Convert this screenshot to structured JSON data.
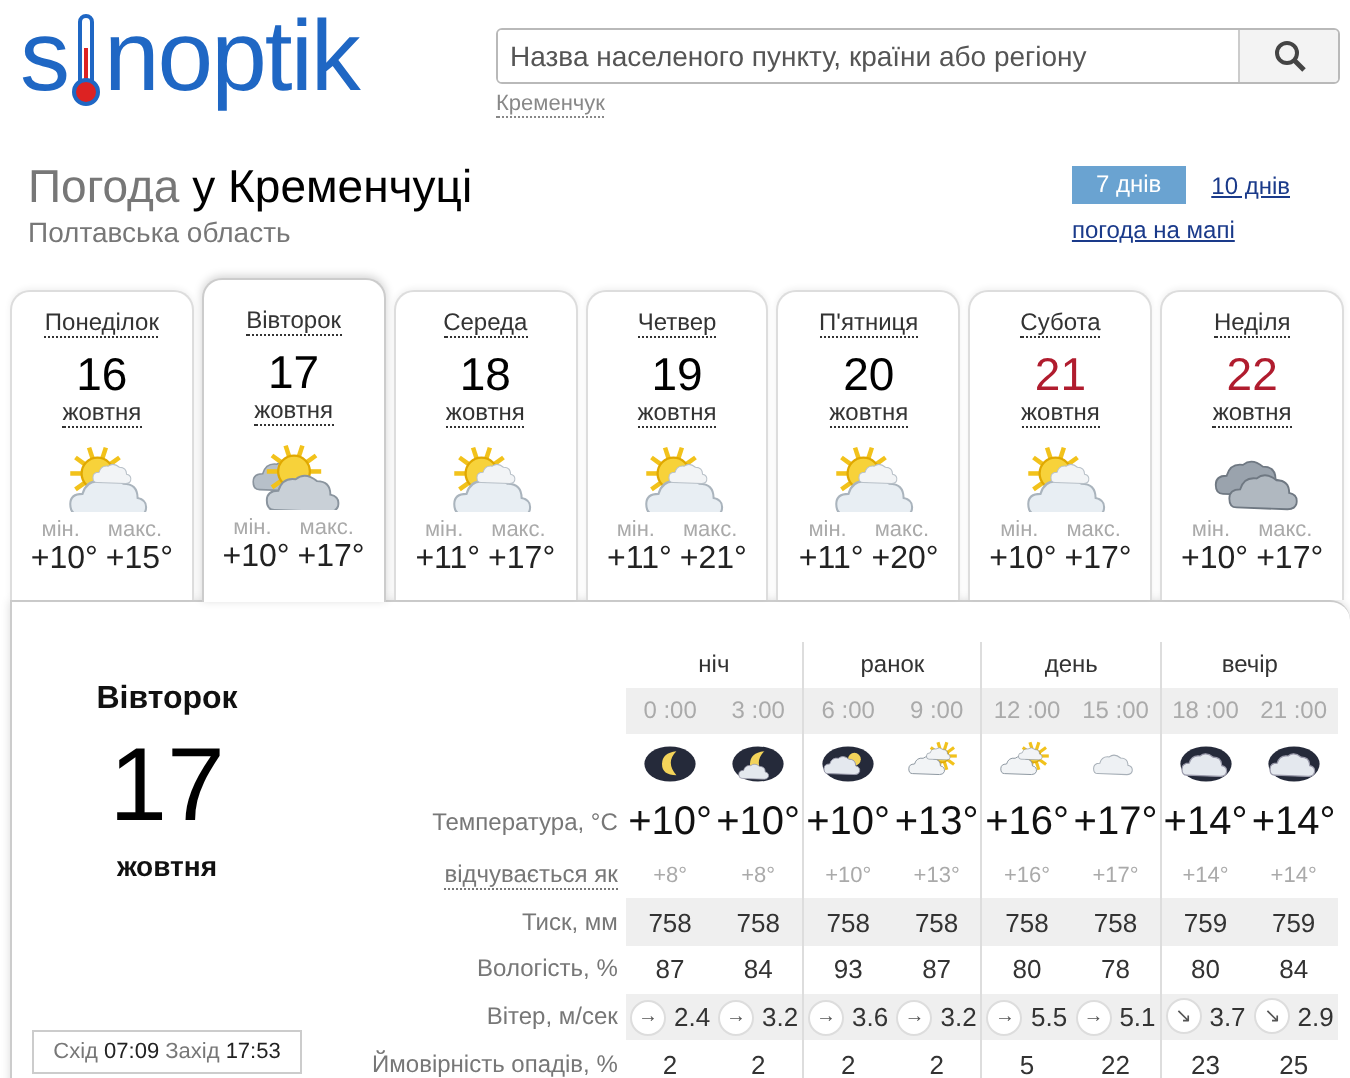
{
  "logo": {
    "before": "s",
    "after": "noptik"
  },
  "search": {
    "placeholder": "Назва населеного пункту, країни або регіону",
    "recent": "Кременчук"
  },
  "title": {
    "prefix": "Погода",
    "place": "у Кременчуці",
    "region": "Полтавська область"
  },
  "views": [
    {
      "label": "7 днів",
      "selected": true
    },
    {
      "label": "10 днів",
      "selected": false
    }
  ],
  "map_link": "погода на мапі",
  "days": [
    {
      "weekday": "Понеділок",
      "day": "16",
      "month": "жовтня",
      "kind": "sun_clouds",
      "min_label": "мін.",
      "max_label": "макс.",
      "min": "+10°",
      "max": "+15°",
      "weekend": false,
      "selected": false
    },
    {
      "weekday": "Вівторок",
      "day": "17",
      "month": "жовтня",
      "kind": "sun_dark_clouds",
      "min_label": "мін.",
      "max_label": "макс.",
      "min": "+10°",
      "max": "+17°",
      "weekend": false,
      "selected": true
    },
    {
      "weekday": "Середа",
      "day": "18",
      "month": "жовтня",
      "kind": "sun_clouds",
      "min_label": "мін.",
      "max_label": "макс.",
      "min": "+11°",
      "max": "+17°",
      "weekend": false,
      "selected": false
    },
    {
      "weekday": "Четвер",
      "day": "19",
      "month": "жовтня",
      "kind": "sun_clouds",
      "min_label": "мін.",
      "max_label": "макс.",
      "min": "+11°",
      "max": "+21°",
      "weekend": false,
      "selected": false
    },
    {
      "weekday": "П'ятниця",
      "day": "20",
      "month": "жовтня",
      "kind": "sun_clouds",
      "min_label": "мін.",
      "max_label": "макс.",
      "min": "+11°",
      "max": "+20°",
      "weekend": false,
      "selected": false
    },
    {
      "weekday": "Субота",
      "day": "21",
      "month": "жовтня",
      "kind": "sun_clouds",
      "min_label": "мін.",
      "max_label": "макс.",
      "min": "+10°",
      "max": "+17°",
      "weekend": true,
      "selected": false
    },
    {
      "weekday": "Неділя",
      "day": "22",
      "month": "жовтня",
      "kind": "overcast",
      "min_label": "мін.",
      "max_label": "макс.",
      "min": "+10°",
      "max": "+17°",
      "weekend": true,
      "selected": false
    }
  ],
  "detail": {
    "weekday": "Вівторок",
    "day": "17",
    "month": "жовтня",
    "sun": {
      "rise_label": "Схід",
      "rise": "07:09",
      "set_label": "Захід",
      "set": "17:53"
    },
    "row_labels": {
      "temperature": "Температура, °C",
      "feels": "відчувається як",
      "pressure": "Тиск, мм",
      "humidity": "Вологість, %",
      "wind": "Вітер, м/сек",
      "precip": "Ймовірність опадів, %"
    },
    "periods": [
      "ніч",
      "ранок",
      "день",
      "вечір"
    ],
    "hours": [
      {
        "time": "0 :00",
        "kind": "night_clear",
        "temp": "+10°",
        "feels": "+8°",
        "pressure": "758",
        "humidity": "87",
        "wind_arrow": "→",
        "wind": "2.4",
        "precip": "2"
      },
      {
        "time": "3 :00",
        "kind": "night_cloud",
        "temp": "+10°",
        "feels": "+8°",
        "pressure": "758",
        "humidity": "84",
        "wind_arrow": "→",
        "wind": "3.2",
        "precip": "2"
      },
      {
        "time": "6 :00",
        "kind": "night_partly",
        "temp": "+10°",
        "feels": "+10°",
        "pressure": "758",
        "humidity": "93",
        "wind_arrow": "→",
        "wind": "3.6",
        "precip": "2"
      },
      {
        "time": "9 :00",
        "kind": "partly",
        "temp": "+13°",
        "feels": "+13°",
        "pressure": "758",
        "humidity": "87",
        "wind_arrow": "→",
        "wind": "3.2",
        "precip": "2"
      },
      {
        "time": "12 :00",
        "kind": "partly",
        "temp": "+16°",
        "feels": "+16°",
        "pressure": "758",
        "humidity": "80",
        "wind_arrow": "→",
        "wind": "5.5",
        "precip": "5"
      },
      {
        "time": "15 :00",
        "kind": "cloud",
        "temp": "+17°",
        "feels": "+17°",
        "pressure": "758",
        "humidity": "78",
        "wind_arrow": "→",
        "wind": "5.1",
        "precip": "22"
      },
      {
        "time": "18 :00",
        "kind": "night_cloudy",
        "temp": "+14°",
        "feels": "+14°",
        "pressure": "759",
        "humidity": "80",
        "wind_arrow": "↘",
        "wind": "3.7",
        "precip": "23"
      },
      {
        "time": "21 :00",
        "kind": "night_cloudy",
        "temp": "+14°",
        "feels": "+14°",
        "pressure": "759",
        "humidity": "84",
        "wind_arrow": "↘",
        "wind": "2.9",
        "precip": "25"
      }
    ]
  }
}
